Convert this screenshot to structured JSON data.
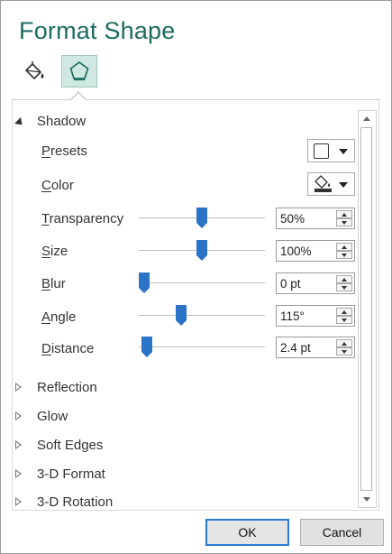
{
  "title": "Format Shape",
  "tabs": [
    {
      "name": "fill-line-tab",
      "icon": "paint-bucket-icon",
      "selected": false
    },
    {
      "name": "effects-tab",
      "icon": "pentagon-icon",
      "selected": true
    }
  ],
  "accent_color": "#1d6b62",
  "selected_tab_color": "#cfe9e2",
  "shadow": {
    "label": "Shadow",
    "expanded": true,
    "presets": {
      "label": "Presets",
      "icon": "shadow-preset-icon"
    },
    "color": {
      "label": "Color",
      "icon": "paint-bucket-icon"
    },
    "sliders": [
      {
        "key": "transparency",
        "label": "Transparency",
        "value": "50%",
        "level": 0.5
      },
      {
        "key": "size",
        "label": "Size",
        "value": "100%",
        "level": 0.5
      },
      {
        "key": "blur",
        "label": "Blur",
        "value": "0 pt",
        "level": 0.0
      },
      {
        "key": "angle",
        "label": "Angle",
        "value": "115°",
        "level": 0.32
      },
      {
        "key": "distance",
        "label": "Distance",
        "value": "2.4 pt",
        "level": 0.02
      }
    ]
  },
  "sections": [
    {
      "label": "Reflection"
    },
    {
      "label": "Glow"
    },
    {
      "label": "Soft Edges"
    },
    {
      "label": "3-D Format"
    },
    {
      "label": "3-D Rotation"
    }
  ],
  "buttons": {
    "ok": "OK",
    "cancel": "Cancel"
  }
}
